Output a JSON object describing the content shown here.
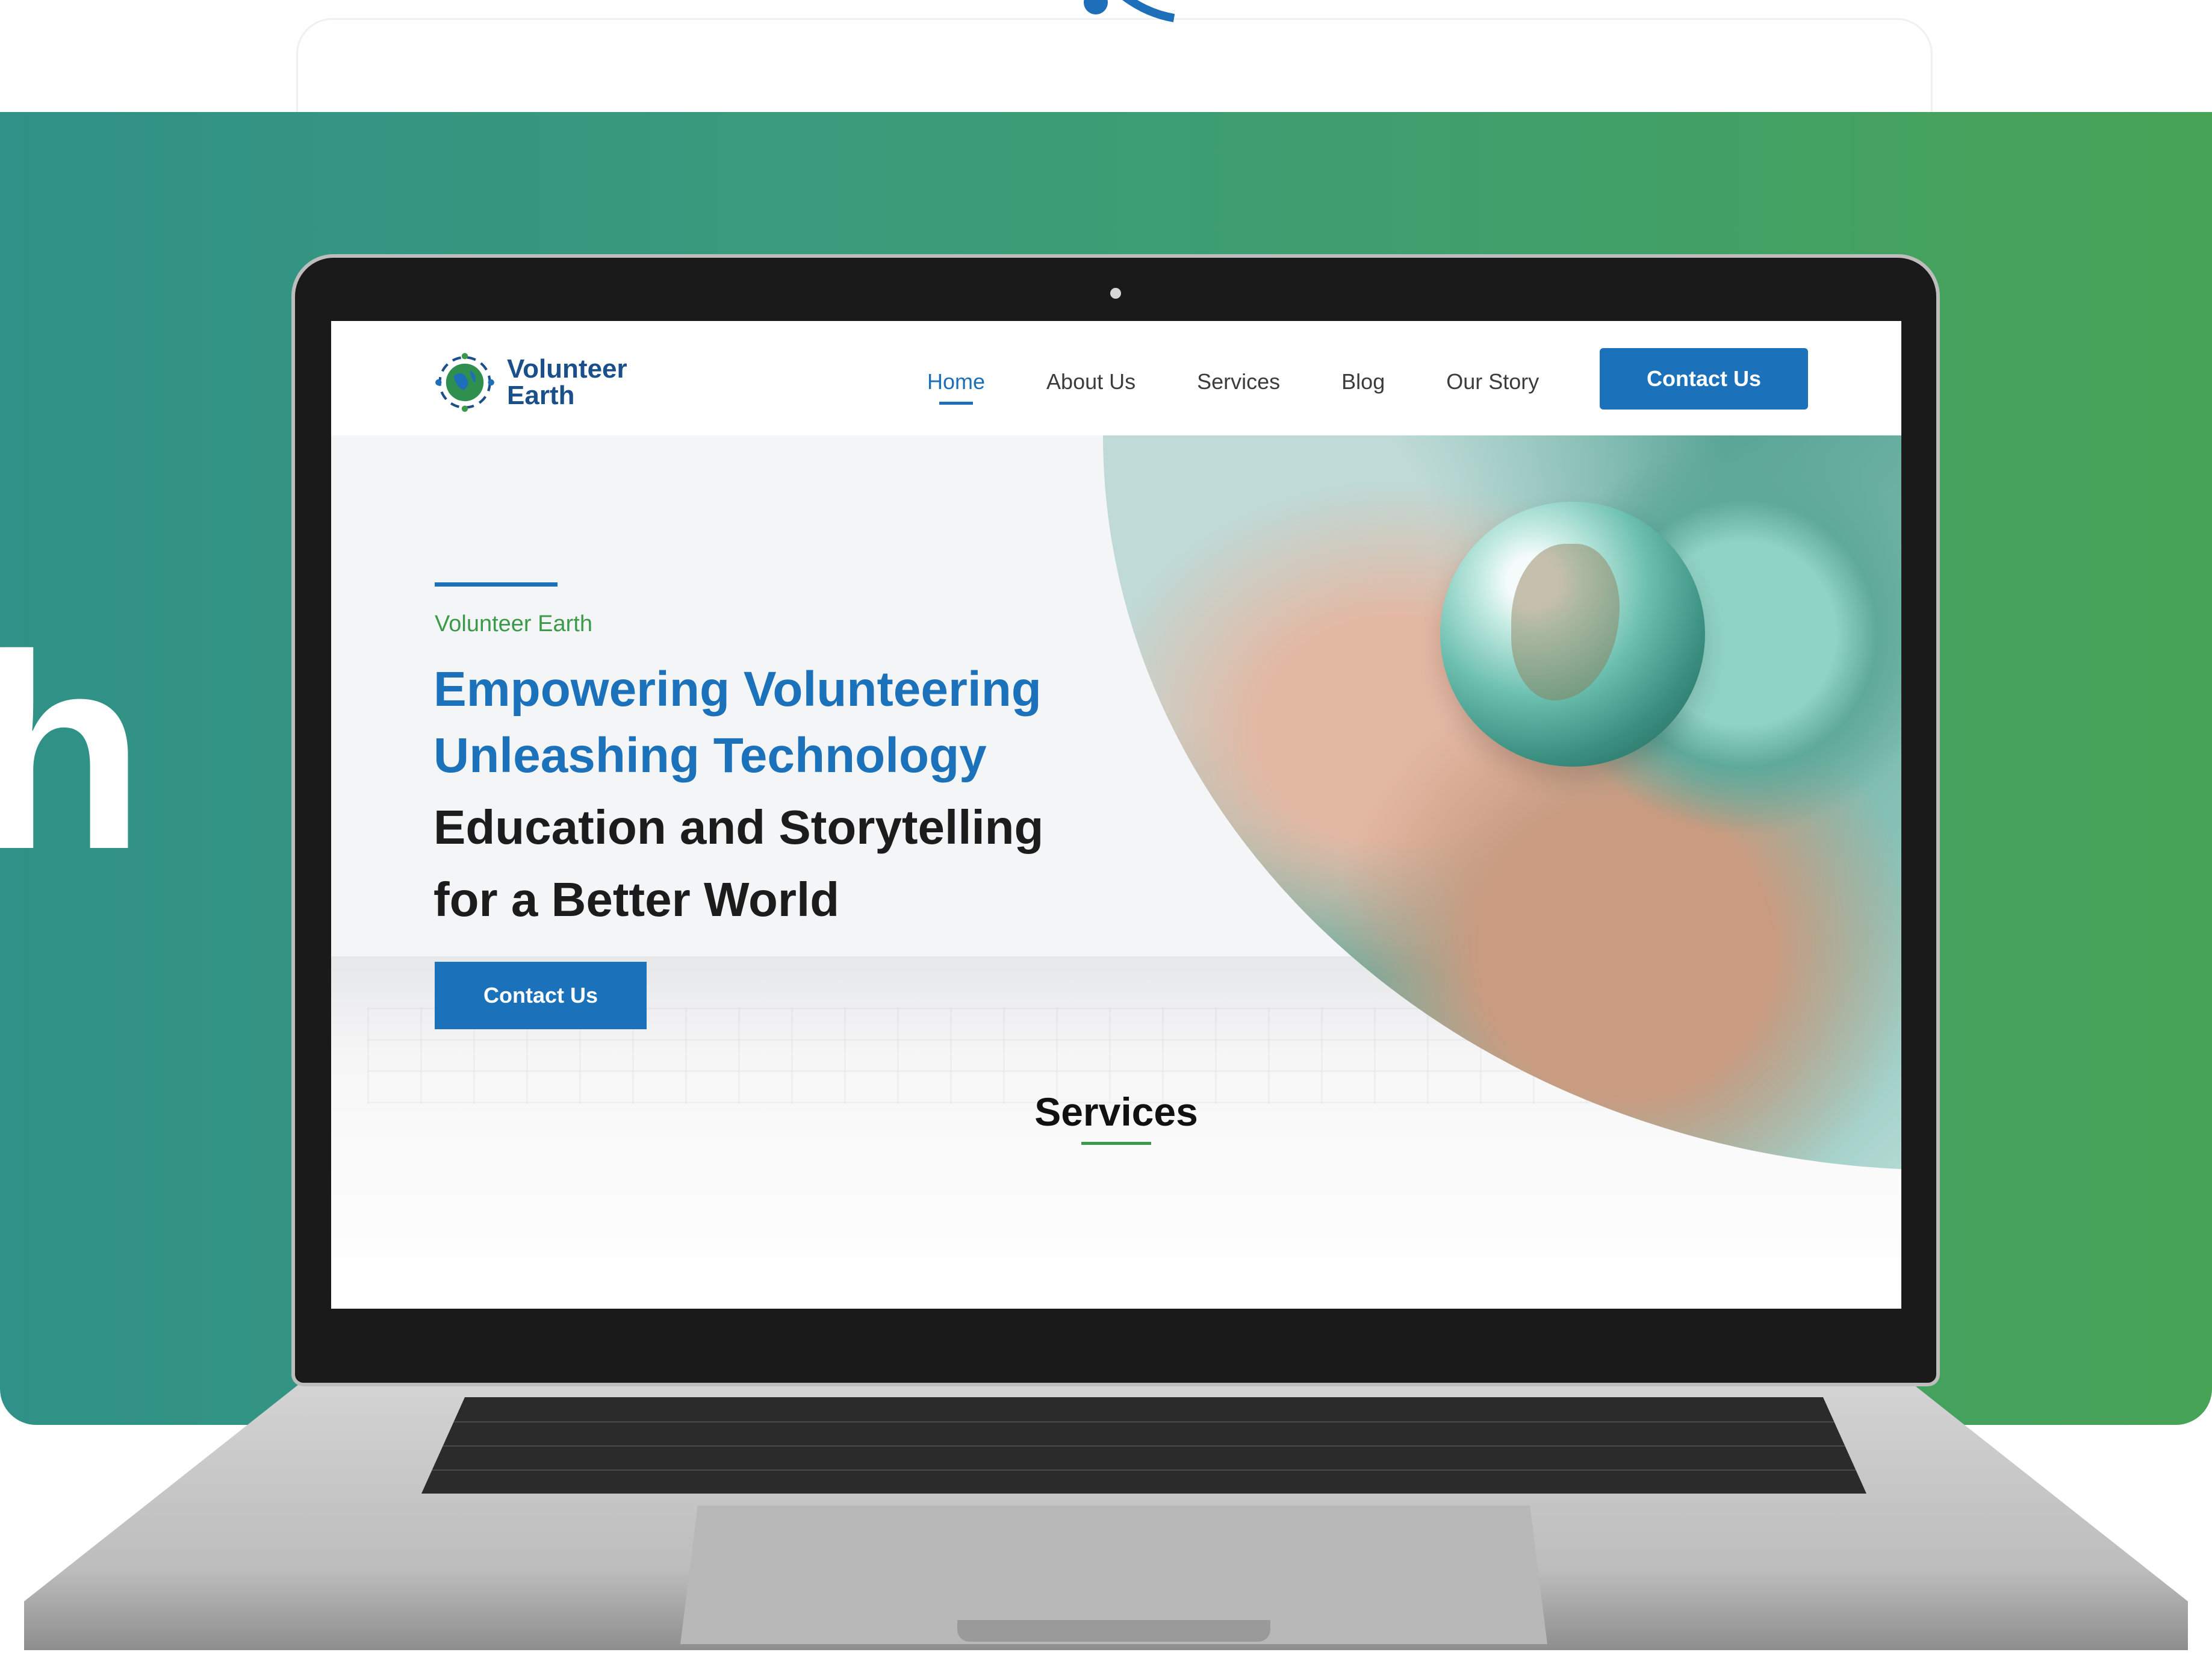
{
  "background": {
    "partial_heading_char": "h",
    "gradient_start": "#2f9187",
    "gradient_end": "#47a356"
  },
  "site": {
    "brand": {
      "line1": "Volunteer",
      "line2": "Earth"
    },
    "nav": {
      "items": [
        {
          "label": "Home",
          "active": true
        },
        {
          "label": "About Us",
          "active": false
        },
        {
          "label": "Services",
          "active": false
        },
        {
          "label": "Blog",
          "active": false
        },
        {
          "label": "Our Story",
          "active": false
        }
      ],
      "cta_label": "Contact Us"
    },
    "hero": {
      "eyebrow": "Volunteer Earth",
      "headline_blue_1": "Empowering Volunteering",
      "headline_blue_2": "Unleashing Technology",
      "headline_dark_1": "Education and Storytelling",
      "headline_dark_2": "for a Better World",
      "cta_label": "Contact Us"
    },
    "services": {
      "title": "Services"
    },
    "colors": {
      "primary": "#1c72ba",
      "accent_green": "#3a9a4a",
      "brand_navy": "#1b4f8a"
    }
  }
}
